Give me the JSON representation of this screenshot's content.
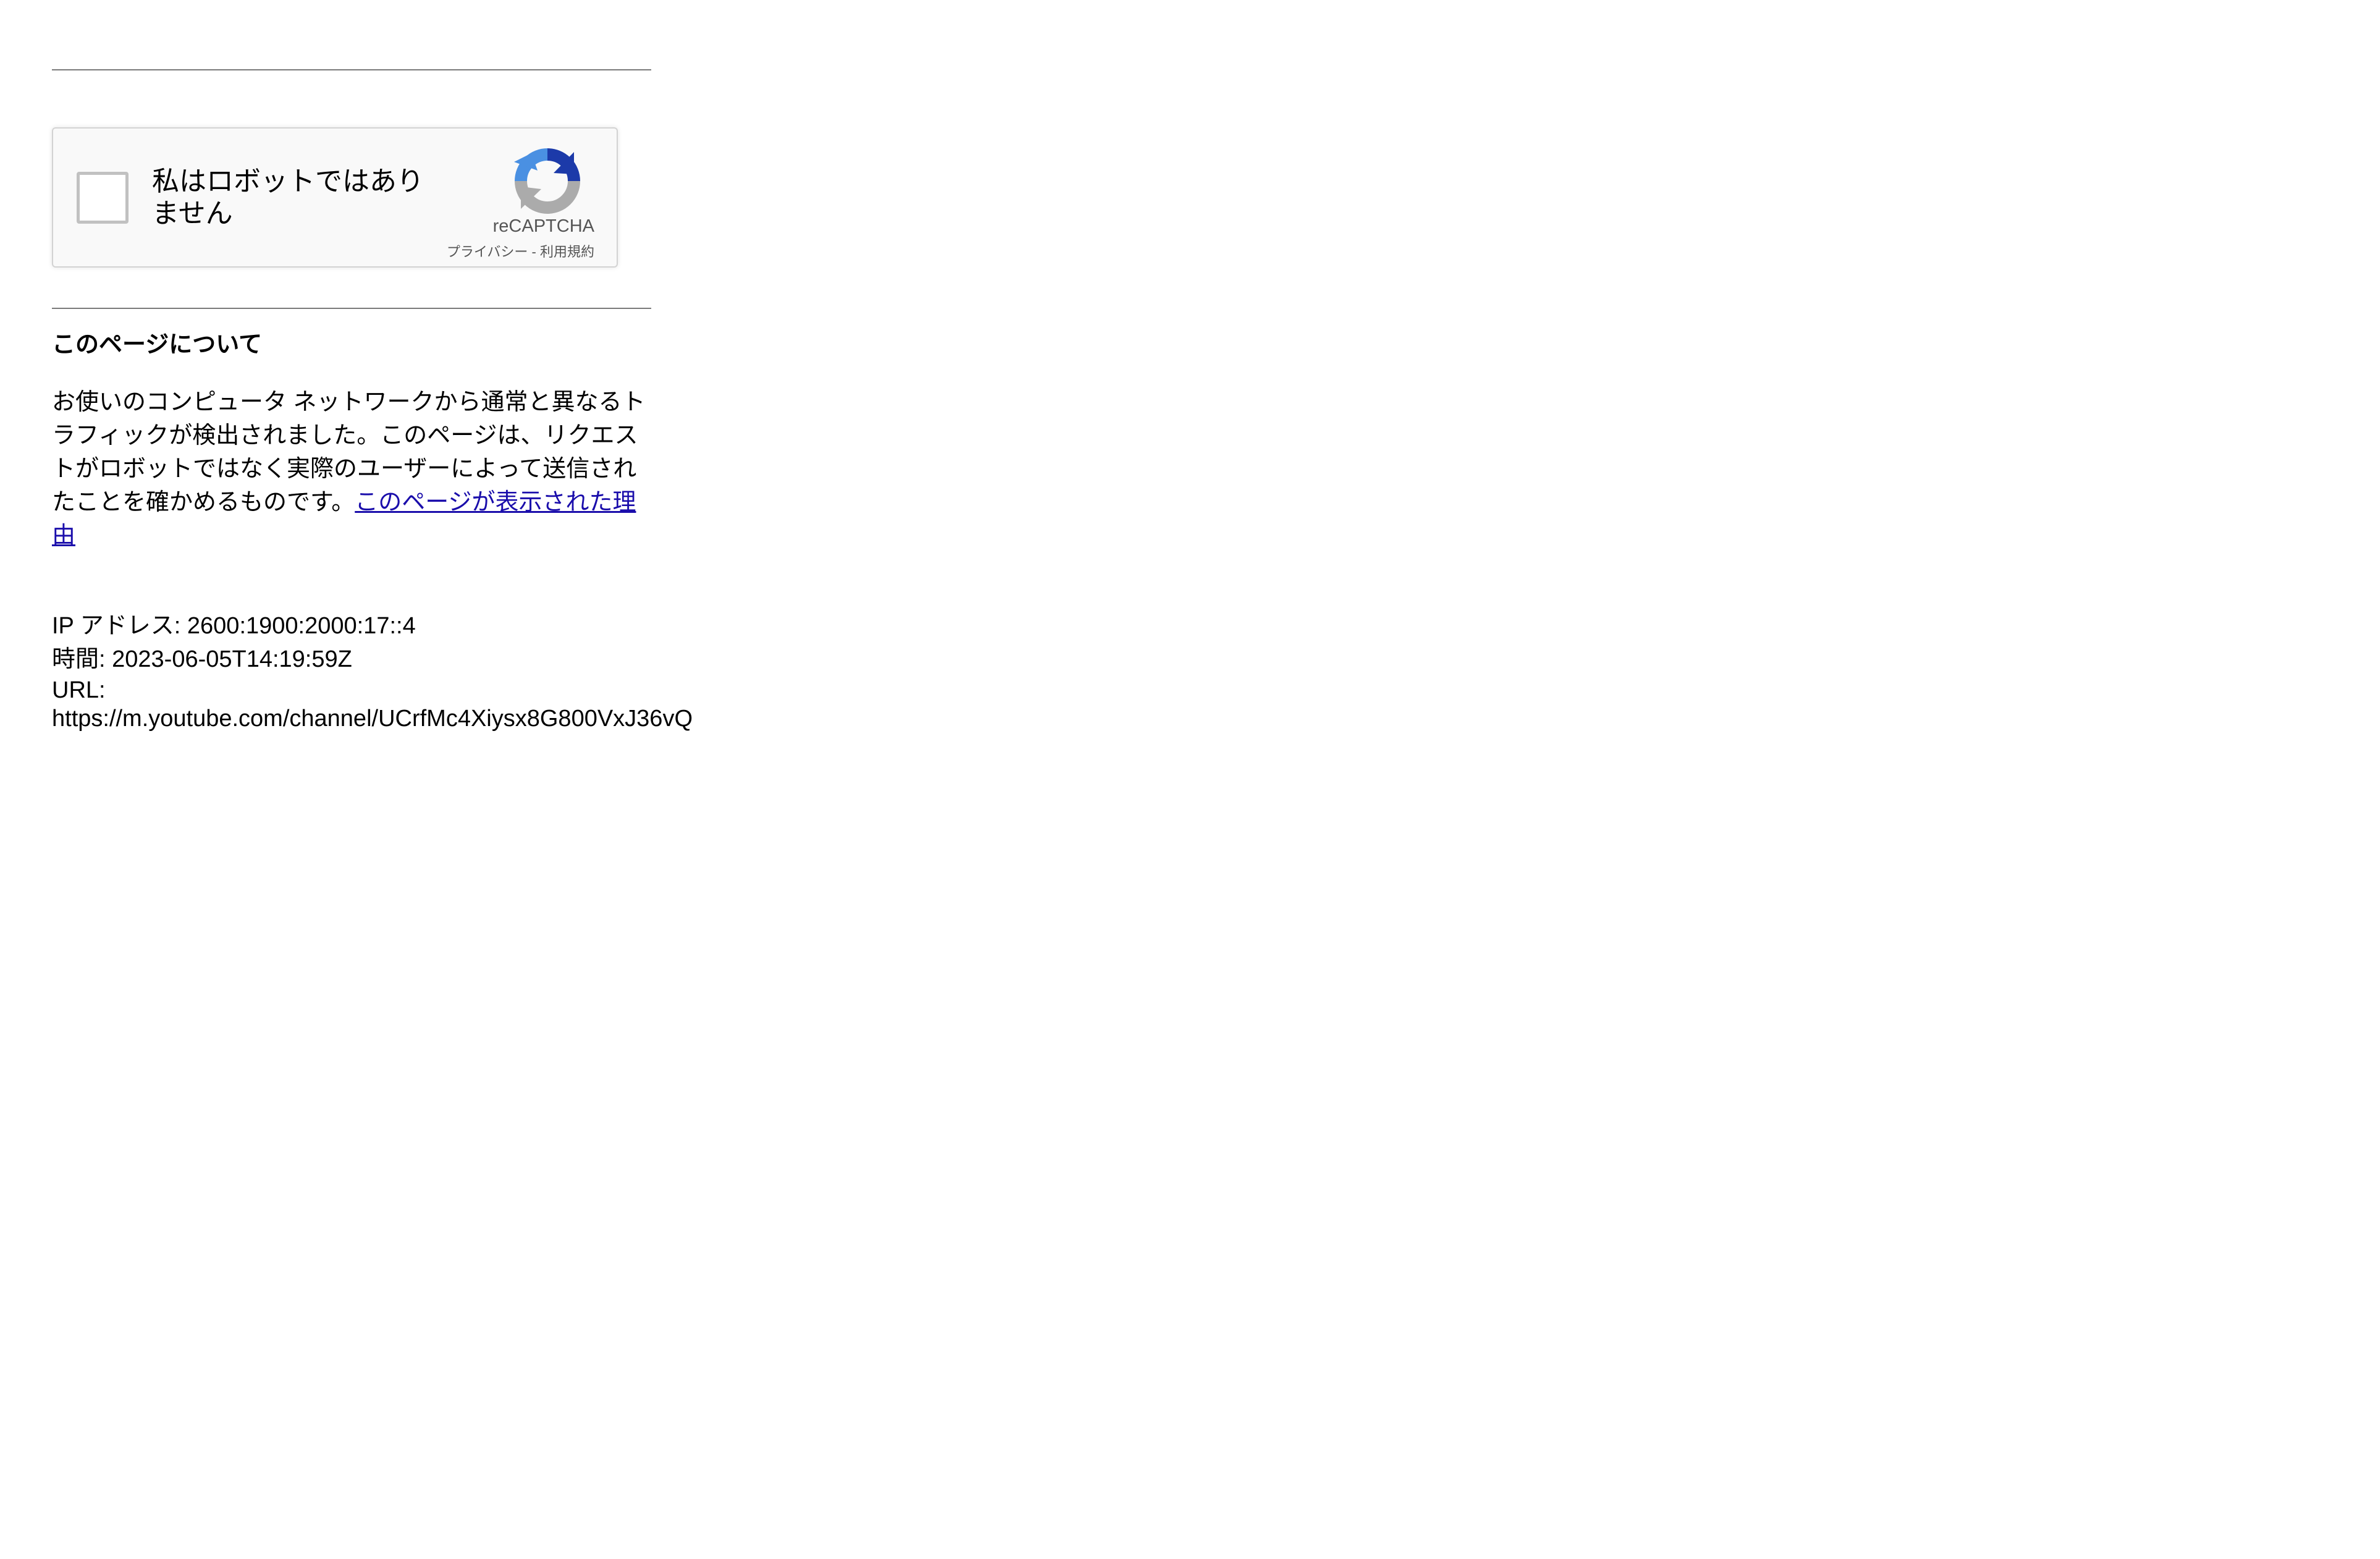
{
  "captcha": {
    "checkbox_label": "私はロボットではありません",
    "brand": "reCAPTCHA",
    "privacy_link": "プライバシー",
    "separator": " - ",
    "terms_link": "利用規約"
  },
  "about": {
    "heading": "このページについて",
    "body": "お使いのコンピュータ ネットワークから通常と異なるトラフィックが検出されました。このページは、リクエストがロボットではなく実際のユーザーによって送信されたことを確かめるものです。",
    "why_link": "このページが表示された理由"
  },
  "details": {
    "ip_label": "IP アドレス:",
    "ip_value": "2600:1900:2000:17::4",
    "time_label": "時間:",
    "time_value": "2023-06-05T14:19:59Z",
    "url_label": "URL:",
    "url_value": "https://m.youtube.com/channel/UCrfMc4Xiysx8G800VxJ36vQ"
  },
  "icons": {
    "recaptcha_logo": "recaptcha-logo-icon"
  },
  "colors": {
    "link": "#1a0dab",
    "recaptcha_blue": "#1c3aa9",
    "recaptcha_light_blue": "#4a90e2",
    "recaptcha_gray": "#ababab"
  }
}
